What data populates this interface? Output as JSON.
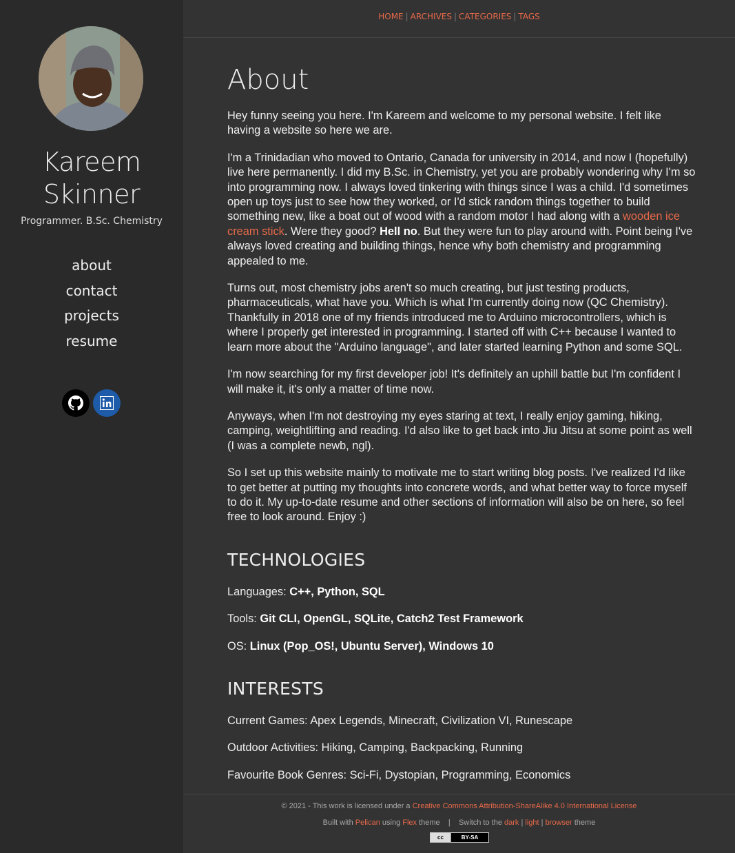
{
  "sidebar": {
    "name_line1": "Kareem",
    "name_line2": "Skinner",
    "subtitle": "Programmer. B.Sc. Chemistry",
    "nav": [
      "about",
      "contact",
      "projects",
      "resume"
    ],
    "social": [
      {
        "icon": "github-icon",
        "color": "#000000"
      },
      {
        "icon": "linkedin-icon",
        "color": "#1e5ba8"
      }
    ]
  },
  "topnav": {
    "items": [
      "HOME",
      "ARCHIVES",
      "CATEGORIES",
      "TAGS"
    ],
    "separator": "|"
  },
  "main": {
    "title": "About",
    "p1": "Hey funny seeing you here. I'm Kareem and welcome to my personal website. I felt like having a website so here we are.",
    "p2_before": "I'm a Trinidadian who moved to Ontario, Canada for university in 2014, and now I (hopefully) live here permanently. I did my B.Sc. in Chemistry, yet you are probably wondering why I'm so into programming now. I always loved tinkering with things since I was a child. I'd sometimes open up toys just to see how they worked, or I'd stick random things together to build something new, like a boat out of wood with a random motor I had along with a ",
    "p2_link": "wooden ice cream stick",
    "p2_mid": ". Were they good? ",
    "p2_bold": "Hell no",
    "p2_after": ". But they were fun to play around with. Point being I've always loved creating and building things, hence why both chemistry and programming appealed to me.",
    "p3": "Turns out, most chemistry jobs aren't so much creating, but just testing products, pharmaceuticals, what have you. Which is what I'm currently doing now (QC Chemistry). Thankfully in 2018 one of my friends introduced me to Arduino microcontrollers, which is where I properly get interested in programming. I started off with C++ because I wanted to learn more about the \"Arduino language\", and later started learning Python and some SQL.",
    "p4": "I'm now searching for my first developer job! It's definitely an uphill battle but I'm confident I will make it, it's only a matter of time now.",
    "p5": "Anyways, when I'm not destroying my eyes staring at text, I really enjoy gaming, hiking, camping, weightlifting and reading. I'd also like to get back into Jiu Jitsu at some point as well (I was a complete newb, ngl).",
    "p6": "So I set up this website mainly to motivate me to start writing blog posts. I've realized I'd like to get better at putting my thoughts into concrete words, and what better way to force myself to do it. My up-to-date resume and other sections of information will also be on here, so feel free to look around. Enjoy :)",
    "tech_heading": "TECHNOLOGIES",
    "tech": [
      {
        "label": "Languages: ",
        "value": "C++, Python, SQL"
      },
      {
        "label": "Tools: ",
        "value": "Git CLI, OpenGL, SQLite, Catch2 Test Framework"
      },
      {
        "label": "OS: ",
        "value": "Linux (Pop_OS!, Ubuntu Server), Windows 10"
      }
    ],
    "interests_heading": "INTERESTS",
    "interests": [
      "Current Games: Apex Legends, Minecraft, Civilization VI, Runescape",
      "Outdoor Activities: Hiking, Camping, Backpacking, Running",
      "Favourite Book Genres: Sci-Fi, Dystopian, Programming, Economics"
    ]
  },
  "footer": {
    "copyright": "© 2021 - This work is licensed under a ",
    "license_link": "Creative Commons Attribution-ShareAlike 4.0 International License",
    "built_with": "Built with ",
    "pelican": "Pelican",
    "using": " using ",
    "flex": "Flex",
    "theme_sep": " theme    |    Switch to the ",
    "dark": "dark",
    "light": "light",
    "browser": "browser",
    "theme_end": " theme",
    "pipe": " | ",
    "badge_left": "cc",
    "badge_right": "BY-SA"
  },
  "colors": {
    "accent": "#e86a4a",
    "background": "#333333",
    "sidebar": "#2a2a2a"
  }
}
